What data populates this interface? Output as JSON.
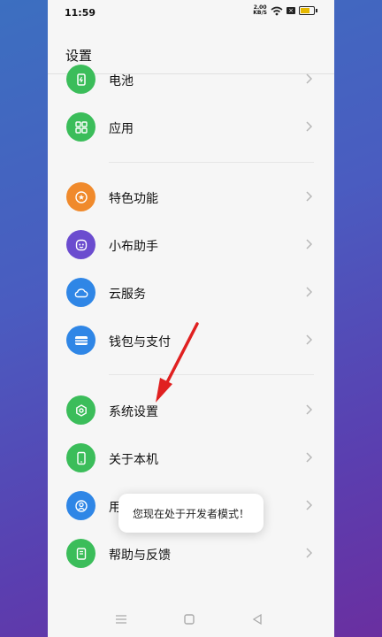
{
  "status_bar": {
    "time": "11:59",
    "net_speed_top": "2.00",
    "net_speed_bottom": "KB/S"
  },
  "header": {
    "title": "设置"
  },
  "items": [
    {
      "label": "电池",
      "color": "#3bbd5a",
      "icon": "battery-icon"
    },
    {
      "label": "应用",
      "color": "#3bbd5a",
      "icon": "apps-grid-icon"
    },
    {
      "label": "特色功能",
      "color": "#f08a2c",
      "icon": "star-badge-icon"
    },
    {
      "label": "小布助手",
      "color": "#6b4ccf",
      "icon": "assistant-icon"
    },
    {
      "label": "云服务",
      "color": "#2f86e6",
      "icon": "cloud-icon"
    },
    {
      "label": "钱包与支付",
      "color": "#2f86e6",
      "icon": "wallet-icon"
    },
    {
      "label": "系统设置",
      "color": "#3bbd5a",
      "icon": "system-settings-icon"
    },
    {
      "label": "关于本机",
      "color": "#3bbd5a",
      "icon": "phone-icon"
    },
    {
      "label": "用",
      "color": "#2f86e6",
      "icon": "user-icon"
    },
    {
      "label": "帮助与反馈",
      "color": "#3bbd5a",
      "icon": "help-book-icon"
    }
  ],
  "toast": {
    "text": "您现在处于开发者模式！"
  },
  "annotation": {
    "arrow_color": "#e02020"
  }
}
